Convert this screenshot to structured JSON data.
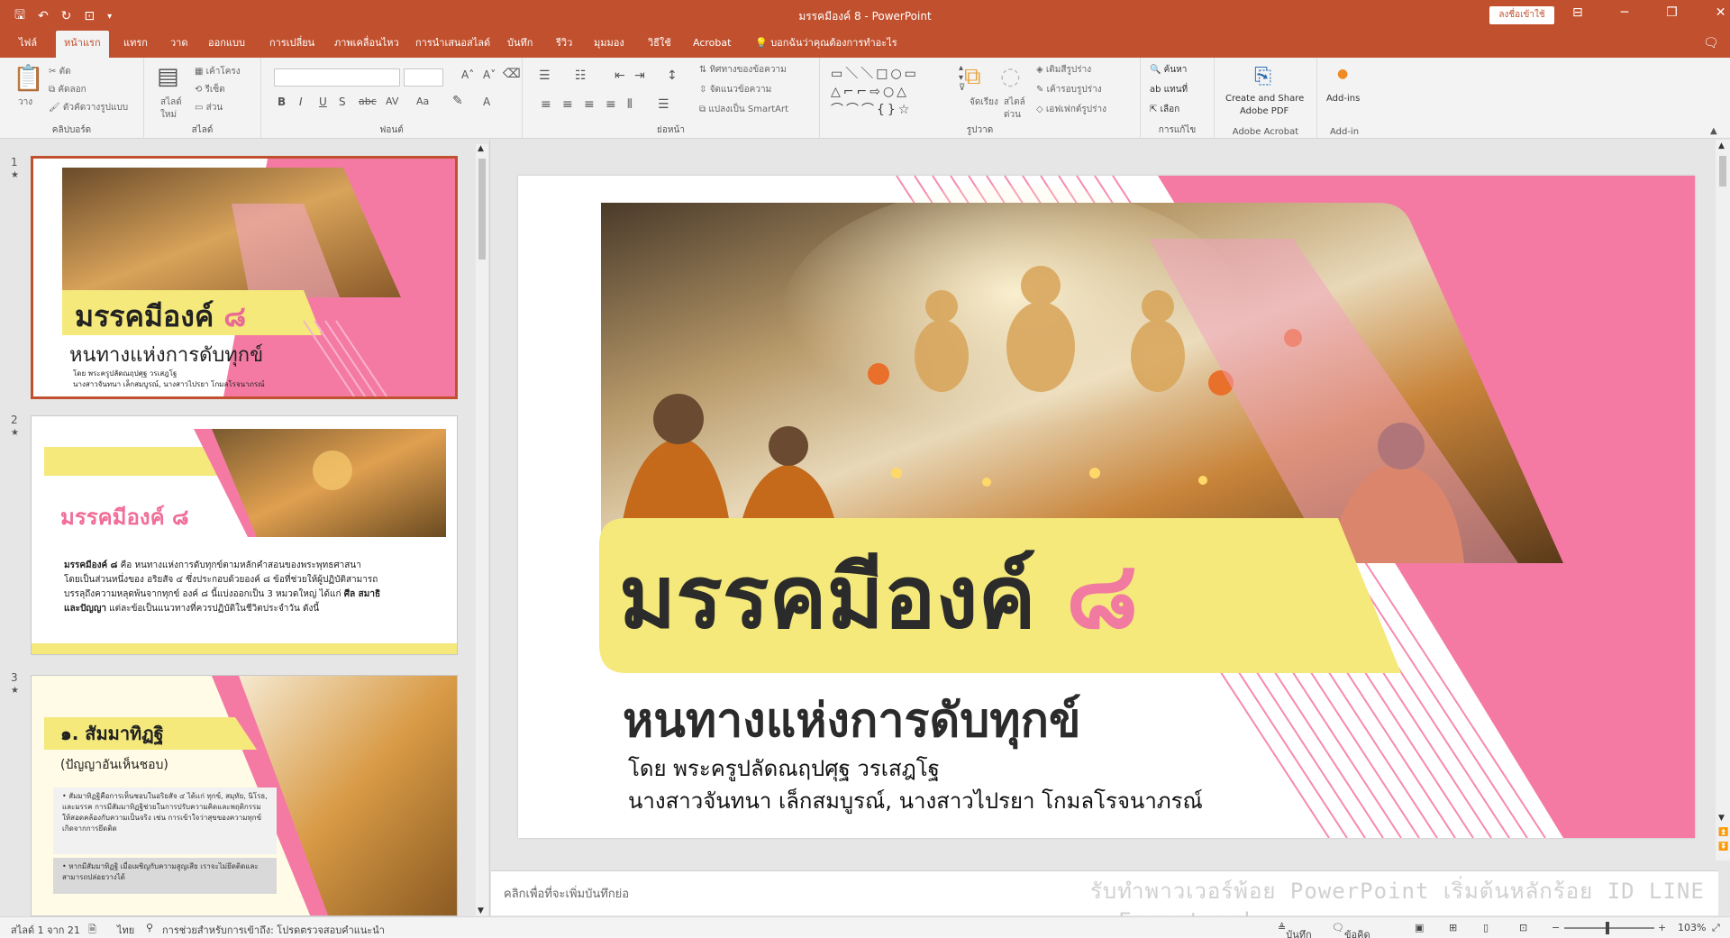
{
  "titlebar": {
    "title": "มรรคมีองค์ 8  -  PowerPoint",
    "signin": "ลงชื่อเข้าใช้"
  },
  "tabs": [
    "ไฟล์",
    "หน้าแรก",
    "แทรก",
    "วาด",
    "ออกแบบ",
    "การเปลี่ยน",
    "ภาพเคลื่อนไหว",
    "การนำเสนอสไลด์",
    "บันทึก",
    "รีวิว",
    "มุมมอง",
    "วิธีใช้",
    "Acrobat"
  ],
  "active_tab": "หน้าแรก",
  "tellme": "บอกฉันว่าคุณต้องการทำอะไร",
  "ribbon": {
    "clipboard": {
      "paste": "วาง",
      "cut": "ตัด",
      "copy": "คัดลอก",
      "format_painter": "ตัวคัดวางรูปแบบ",
      "label": "คลิปบอร์ด"
    },
    "slides": {
      "new_slide": "สไลด์",
      "new": "ใหม่",
      "layout": "เค้าโครง",
      "reset": "รีเซ็ต",
      "section": "ส่วน",
      "label": "สไลด์"
    },
    "font": {
      "label": "ฟอนต์"
    },
    "paragraph": {
      "text_direction": "ทิศทางของข้อความ",
      "align_text": "จัดแนวข้อความ",
      "smartart": "แปลงเป็น SmartArt",
      "label": "ย่อหน้า"
    },
    "drawing": {
      "arrange": "จัดเรียง",
      "quick_styles": "สไตล์",
      "quick_styles2": "ด่วน",
      "fill": "เติมสีรูปร่าง",
      "outline": "เค้ารอบรูปร่าง",
      "effects": "เอฟเฟกต์รูปร่าง",
      "label": "รูปวาด"
    },
    "editing": {
      "find": "ค้นหา",
      "replace": "แทนที่",
      "select": "เลือก",
      "label": "การแก้ไข"
    },
    "acrobat": {
      "create1": "Create and Share",
      "create2": "Adobe PDF",
      "label": "Adobe Acrobat"
    },
    "addins": {
      "addins": "Add-ins",
      "label": "Add-in"
    }
  },
  "thumbnails": {
    "t1": {
      "num": "1",
      "title": "มรรคมีองค์",
      "numeral": "๘",
      "subtitle": "หนทางแห่งการดับทุกข์",
      "by1": "โดย พระครูปลัดณฤปศุฐ วรเสฎโฐ",
      "by2": "นางสาวจันทนา เล็กสมบูรณ์, นางสาวไปรยา โกมลโรจนาภรณ์"
    },
    "t2": {
      "num": "2",
      "title": "มรรคมีองค์ ๘",
      "bold1": "มรรคมีองค์ ๘",
      "p1": " คือ หนทางแห่งการดับทุกข์ตามหลักคำสอนของพระพุทธศาสนา",
      "p2": "โดยเป็นส่วนหนึ่งของ อริยสัจ ๔ ซึ่งประกอบด้วยองค์ ๘ ข้อที่ช่วยให้ผู้ปฏิบัติสามารถ",
      "p3": "บรรลุถึงความหลุดพ้นจากทุกข์ องค์ ๘ นี้แบ่งออกเป็น 3 หมวดใหญ่ ได้แก่ ",
      "bold2": "ศีล สมาธิ",
      "bold3": "และปัญญา",
      "p4": " แต่ละข้อเป็นแนวทางที่ควรปฏิบัติในชีวิตประจำวัน ดังนี้"
    },
    "t3": {
      "num": "3",
      "title": "๑. สัมมาทิฏฐิ",
      "subtitle": "(ปัญญาอันเห็นชอบ)",
      "b1": "สัมมาทิฏฐิคือการเห็นชอบในอริยสัจ ๔ ได้แก่ ทุกข์, สมุทัย, นิโรธ, และมรรค การมีสัมมาทิฏฐิช่วยในการปรับความคิดและพฤติกรรมให้สอดคล้องกับความเป็นจริง เช่น การเข้าใจว่าสุขของความทุกข์เกิดจากการยึดติด",
      "b2": "หากมีสัมมาทิฏฐิ เมื่อเผชิญกับความสูญเสีย เราจะไม่ยึดติดและสามารถปล่อยวางได้"
    }
  },
  "slide": {
    "title": "มรรคมีองค์",
    "numeral": "๘",
    "subtitle": "หนทางแห่งการดับทุกข์",
    "by1": "โดย พระครูปลัดณฤปศุฐ วรเสฎโฐ",
    "by2": "นางสาวจันทนา เล็กสมบูรณ์, นางสาวไปรยา โกมลโรจนาภรณ์"
  },
  "notes": {
    "placeholder": "คลิกเพื่อที่จะเพิ่มบันทึกย่อ",
    "watermark": "รับทำพาวเวอร์พ้อย PowerPoint เริ่มต้นหลักร้อย ID LINE : Forartwork"
  },
  "status": {
    "slide_of": "สไลด์ 1 จาก 21",
    "lang": "ไทย",
    "accessibility": "การช่วยสำหรับการเข้าถึง: โปรดตรวจสอบคำแนะนำ",
    "notes": "บันทึกย่อ",
    "comments": "ข้อคิดเห็น",
    "zoom": "103%"
  },
  "colors": {
    "accent": "#c1502e",
    "pink": "#f47aa4",
    "yellow": "#f4e97a"
  }
}
